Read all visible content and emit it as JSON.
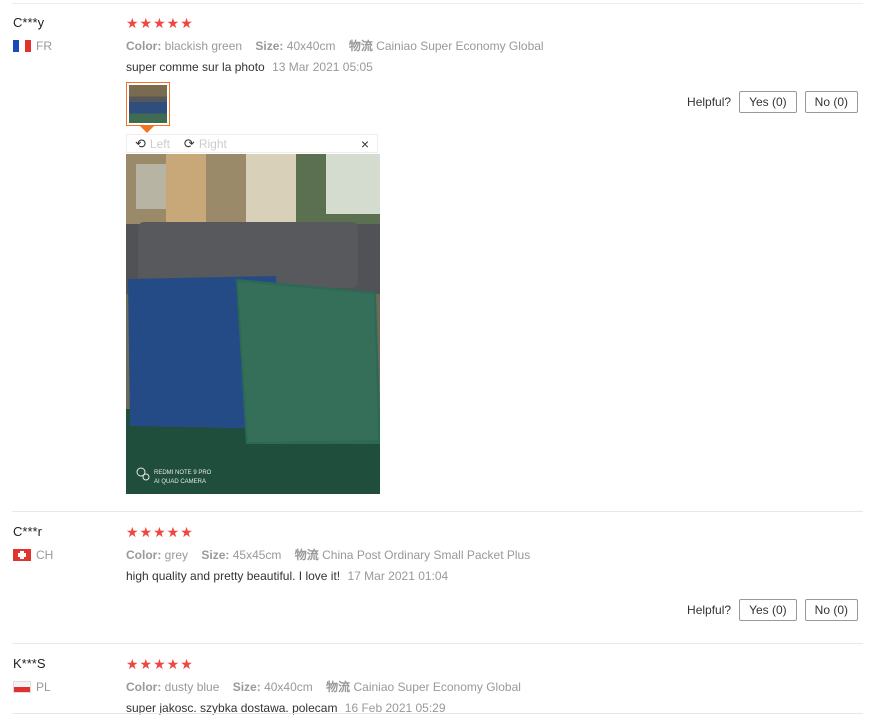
{
  "reviews": [
    {
      "user": "C***y",
      "country": "FR",
      "stars": "★★★★★",
      "color_label": "Color:",
      "color_value": "blackish green",
      "size_label": "Size:",
      "size_value": "40x40cm",
      "ship_label": "物流",
      "ship_value": "Cainiao Super Economy Global",
      "text": "super comme sur la photo",
      "date": "13 Mar 2021 05:05",
      "helpful_label": "Helpful?",
      "yes_label": "Yes (0)",
      "no_label": "No (0)"
    },
    {
      "user": "C***r",
      "country": "CH",
      "stars": "★★★★★",
      "color_label": "Color:",
      "color_value": "grey",
      "size_label": "Size:",
      "size_value": "45x45cm",
      "ship_label": "物流",
      "ship_value": "China Post Ordinary Small Packet Plus",
      "text": "high quality and pretty beautiful. I love it!",
      "date": "17 Mar 2021 01:04",
      "helpful_label": "Helpful?",
      "yes_label": "Yes (0)",
      "no_label": "No (0)"
    },
    {
      "user": "K***S",
      "country": "PL",
      "stars": "★★★★★",
      "color_label": "Color:",
      "color_value": "dusty blue",
      "size_label": "Size:",
      "size_value": "40x40cm",
      "ship_label": "物流",
      "ship_value": "Cainiao Super Economy Global",
      "text": "super jakosc. szybka dostawa. polecam",
      "date": "16 Feb 2021 05:29"
    }
  ],
  "viewer": {
    "left_label": "Left",
    "right_label": "Right",
    "close_icon": "×",
    "photo_caption_line1": "REDMI NOTE 9 PRO",
    "photo_caption_line2": "AI QUAD CAMERA"
  },
  "colors": {
    "star": "#f0463f",
    "thumb_border": "#f57224"
  }
}
